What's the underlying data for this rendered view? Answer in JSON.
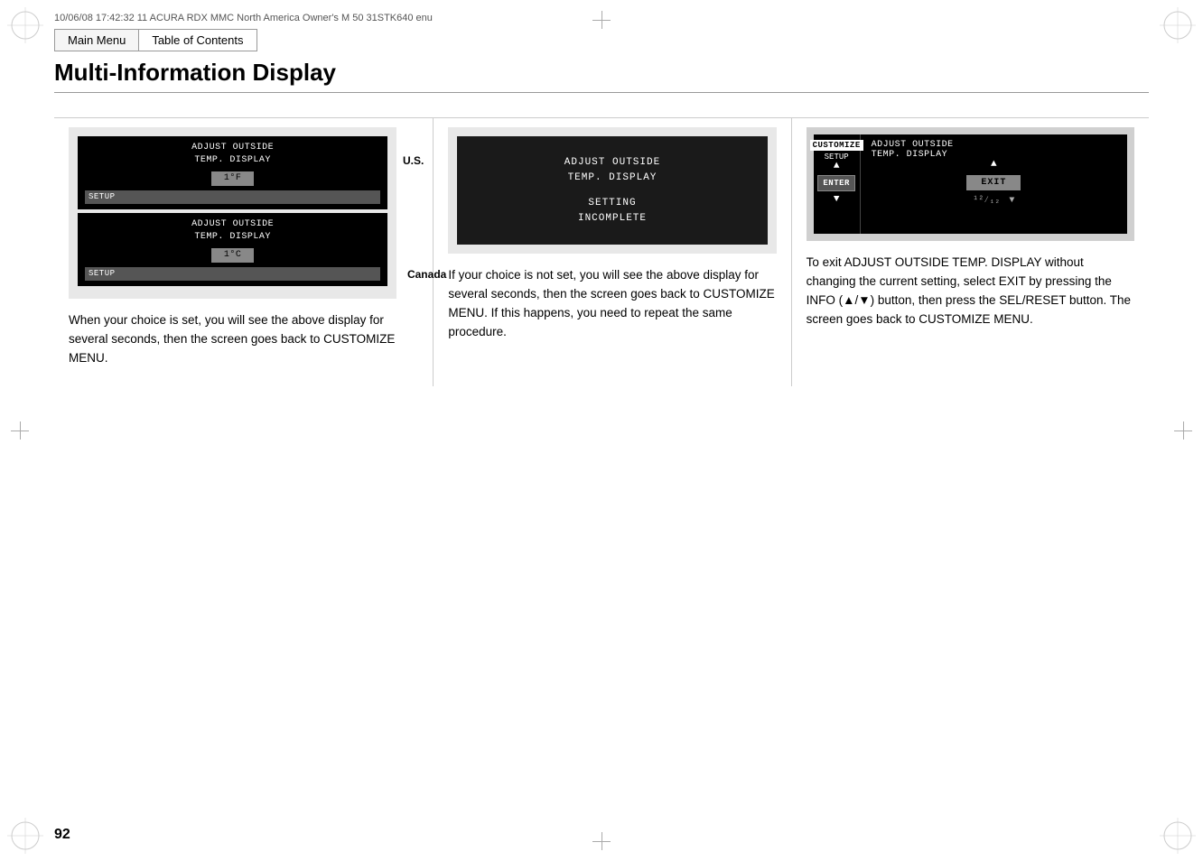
{
  "header": {
    "meta_line": "10/06/08 17:42:32    11 ACURA RDX MMC North America Owner's M 50 31STK640 enu",
    "nav_main": "Main Menu",
    "nav_toc": "Table of Contents",
    "page_title": "Multi-Information Display"
  },
  "columns": [
    {
      "id": "col1",
      "label_us": "U.S.",
      "label_canada": "Canada",
      "screen1_top": {
        "line1": "ADJUST OUTSIDE",
        "line2": "TEMP. DISPLAY",
        "value": "1°F",
        "setup": "SETUP"
      },
      "screen1_bottom": {
        "line1": "ADJUST OUTSIDE",
        "line2": "TEMP. DISPLAY",
        "value": "1°C",
        "setup": "SETUP"
      },
      "body_text": "When your choice is set, you will see the above display for several seconds, then the screen goes back to CUSTOMIZE MENU."
    },
    {
      "id": "col2",
      "screen2": {
        "line1": "ADJUST OUTSIDE",
        "line2": "TEMP. DISPLAY",
        "line3": "SETTING",
        "line4": "INCOMPLETE"
      },
      "body_text": "If your choice is not set, you will see the above display for several seconds, then the screen goes back to CUSTOMIZE MENU. If this happens, you need to repeat the same procedure."
    },
    {
      "id": "col3",
      "screen3": {
        "customize": "CUSTOMIZE",
        "setup": "SETUP",
        "enter": "ENTER",
        "title_right": "ADJUST OUTSIDE TEMP. DISPLAY",
        "exit": "EXIT",
        "fraction": "12/12"
      },
      "body_text": "To exit ADJUST OUTSIDE TEMP. DISPLAY without changing the current setting, select EXIT by pressing the INFO (▲/▼) button, then press the SEL/RESET button. The screen goes back to CUSTOMIZE MENU."
    }
  ],
  "page_number": "92"
}
